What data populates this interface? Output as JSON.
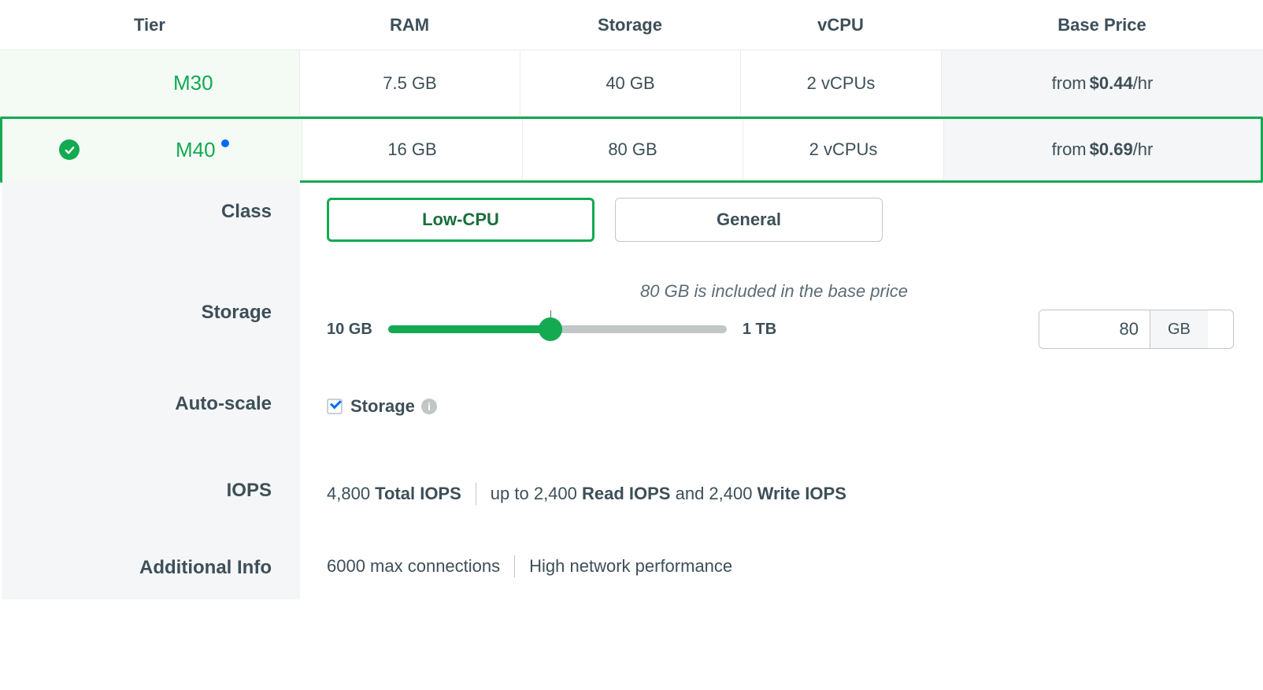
{
  "headers": {
    "tier": "Tier",
    "ram": "RAM",
    "storage": "Storage",
    "vcpu": "vCPU",
    "price": "Base Price"
  },
  "tiers": [
    {
      "name": "M30",
      "ram": "7.5 GB",
      "storage": "40 GB",
      "vcpu": "2 vCPUs",
      "price_from": "from ",
      "price": "$0.44",
      "per": "/hr",
      "selected": false,
      "dot": false
    },
    {
      "name": "M40",
      "ram": "16 GB",
      "storage": "80 GB",
      "vcpu": "2 vCPUs",
      "price_from": "from ",
      "price": "$0.69",
      "per": "/hr",
      "selected": true,
      "dot": true
    }
  ],
  "details": {
    "class": {
      "label": "Class",
      "options": {
        "low": "Low-CPU",
        "general": "General"
      }
    },
    "storage": {
      "label": "Storage",
      "included_note": "80 GB is included in the base price",
      "min_label": "10 GB",
      "max_label": "1 TB",
      "value": "80",
      "unit": "GB"
    },
    "autoscale": {
      "label": "Auto-scale",
      "storage_label": "Storage"
    },
    "iops": {
      "label": "IOPS",
      "total_num": "4,800",
      "total_word": " Total IOPS",
      "up_to": "up to ",
      "read_num": "2,400",
      "read_word": " Read IOPS",
      "and": " and ",
      "write_num": "2,400",
      "write_word": " Write IOPS"
    },
    "addl": {
      "label": "Additional Info",
      "conn": "6000 max connections",
      "net": "High network performance"
    }
  }
}
